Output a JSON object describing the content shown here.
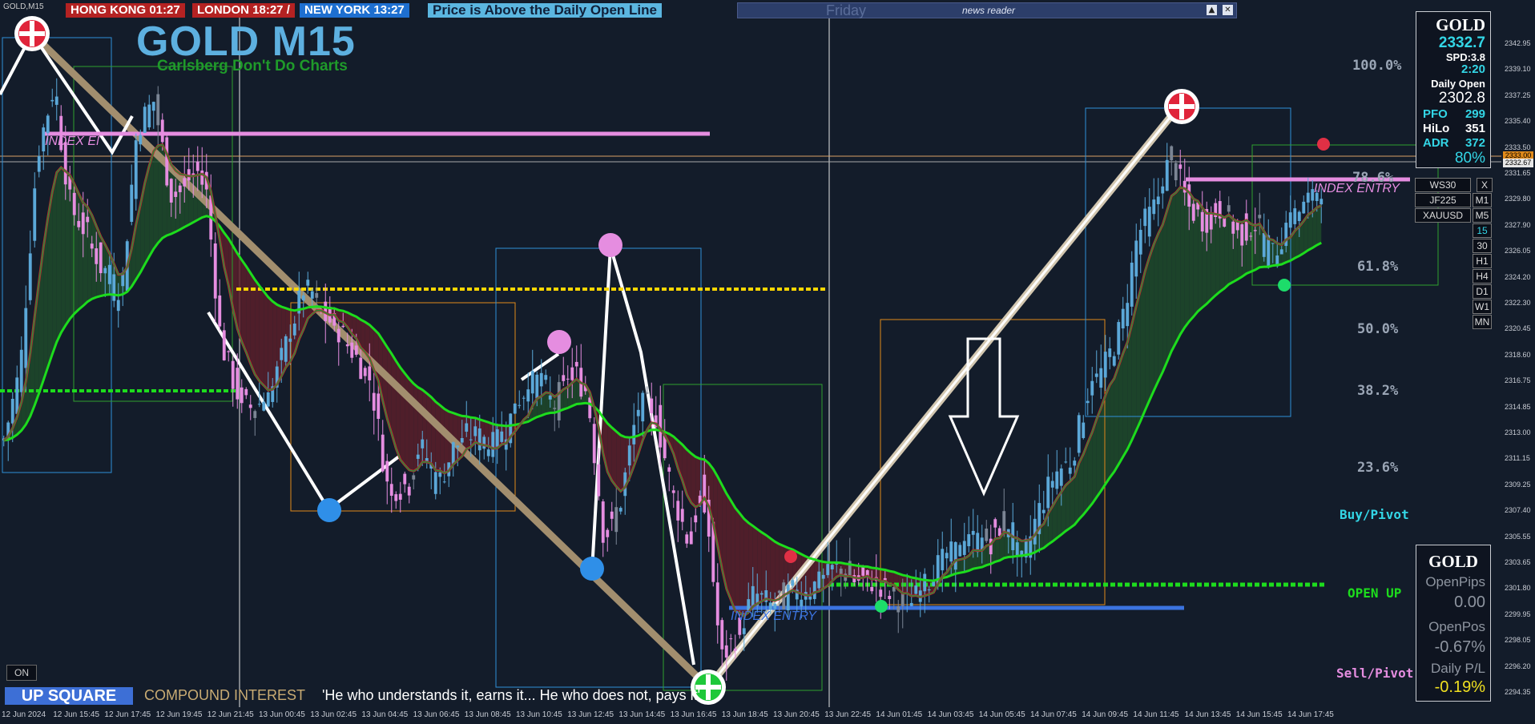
{
  "header": {
    "symbol_tag": "GOLD,M15",
    "clocks": [
      {
        "label": "HONG KONG 01:27",
        "color": "#b42222"
      },
      {
        "label": "LONDON  18:27 /",
        "color": "#b42222"
      },
      {
        "label": "NEW YORK 13:27",
        "color": "#1e6fd0"
      }
    ],
    "price_status": "Price is Above the Daily Open Line",
    "news_day": "Friday",
    "news_reader": "news reader"
  },
  "title": "GOLD M15",
  "subtitle": "Carlsberg Don't Do Charts",
  "info": {
    "name": "GOLD",
    "price": "2332.7",
    "spd": "SPD:3.8",
    "timer": "2:20",
    "daily_open_label": "Daily Open",
    "daily_open": "2302.8",
    "pfo_label": "PFO",
    "pfo": "299",
    "hilo_label": "HiLo",
    "hilo": "351",
    "adr_label": "ADR",
    "adr": "372",
    "adr_pct": "80%"
  },
  "symbols": [
    "WS30",
    "JF225",
    "XAUUSD"
  ],
  "symbol_close": "X",
  "timeframes": [
    "M1",
    "M5",
    "15",
    "30",
    "H1",
    "H4",
    "D1",
    "W1",
    "MN"
  ],
  "fib_levels": [
    "100.0%",
    "78.6%",
    "61.8%",
    "50.0%",
    "38.2%",
    "23.6%"
  ],
  "levels": {
    "buy_pivot": "Buy/Pivot",
    "open_up": "OPEN UP",
    "sell_pivot": "Sell/Pivot"
  },
  "entries": [
    "INDEX ENTRY",
    "INDEX ENTRY",
    "INDEX ENTRY"
  ],
  "pnl": {
    "name": "GOLD",
    "open_pips_label": "OpenPips",
    "open_pips": "0.00",
    "open_pos_label": "OpenPos",
    "open_pos": "-0.67%",
    "daily_pl_label": "Daily P/L",
    "daily_pl": "-0.19%"
  },
  "footer": {
    "on_button": "ON",
    "up_square": "UP SQUARE",
    "compound": "COMPOUND INTEREST",
    "quote": "'He who understands it, earns it... He who does not, pays it'"
  },
  "colors": {
    "background": "#131c2a",
    "bull_candle": "#5ba8d8",
    "bear_candle": "#e58de0",
    "neutral_candle": "#7b8594",
    "cloud_bear": "#5a1f2a",
    "cloud_bull": "#1f4a2a",
    "ema_fast": "#c0252a",
    "ema_slow": "#1ddc1d"
  },
  "chart_data": {
    "type": "candlestick",
    "symbol": "GOLD",
    "timeframe": "M15",
    "x_tick_labels": [
      "12 Jun 2024",
      "12 Jun 15:45",
      "12 Jun 17:45",
      "12 Jun 19:45",
      "12 Jun 21:45",
      "13 Jun 00:45",
      "13 Jun 02:45",
      "13 Jun 04:45",
      "13 Jun 06:45",
      "13 Jun 08:45",
      "13 Jun 10:45",
      "13 Jun 12:45",
      "13 Jun 14:45",
      "13 Jun 16:45",
      "13 Jun 18:45",
      "13 Jun 20:45",
      "13 Jun 22:45",
      "14 Jun 01:45",
      "14 Jun 03:45",
      "14 Jun 05:45",
      "14 Jun 07:45",
      "14 Jun 09:45",
      "14 Jun 11:45",
      "14 Jun 13:45",
      "14 Jun 15:45",
      "14 Jun 17:45"
    ],
    "y_tick_labels": [
      "2342.95",
      "2339.10",
      "2337.25",
      "2335.40",
      "2333.50",
      "2331.65",
      "2329.80",
      "2327.90",
      "2326.05",
      "2324.20",
      "2322.30",
      "2320.45",
      "2318.60",
      "2316.75",
      "2314.85",
      "2313.00",
      "2311.15",
      "2309.25",
      "2307.40",
      "2305.55",
      "2303.65",
      "2301.80",
      "2299.95",
      "2298.05",
      "2296.20",
      "2294.35"
    ],
    "price_tags": [
      "2333.00",
      "2332.67"
    ],
    "ylim": [
      2293.5,
      2343.8
    ],
    "close_path": [
      2313.5,
      2319,
      2335,
      2340,
      2331,
      2329,
      2326,
      2324,
      2337,
      2339,
      2332,
      2333,
      2334,
      2321,
      2317,
      2316,
      2317,
      2321,
      2325,
      2323,
      2322,
      2320,
      2318,
      2310,
      2310,
      2313,
      2310,
      2313,
      2314,
      2313,
      2314,
      2317,
      2318,
      2316,
      2319,
      2317,
      2306,
      2309,
      2316,
      2316,
      2310,
      2306,
      2310,
      2297,
      2299,
      2302,
      2301,
      2302,
      2302,
      2303,
      2304,
      2303,
      2303,
      2302,
      2301,
      2302.5,
      2304,
      2305,
      2306,
      2306,
      2307.5,
      2304,
      2308,
      2311,
      2312,
      2317,
      2319,
      2322,
      2329,
      2331,
      2335,
      2331,
      2330,
      2331,
      2329,
      2330,
      2327,
      2330,
      2331,
      2332.7
    ]
  }
}
